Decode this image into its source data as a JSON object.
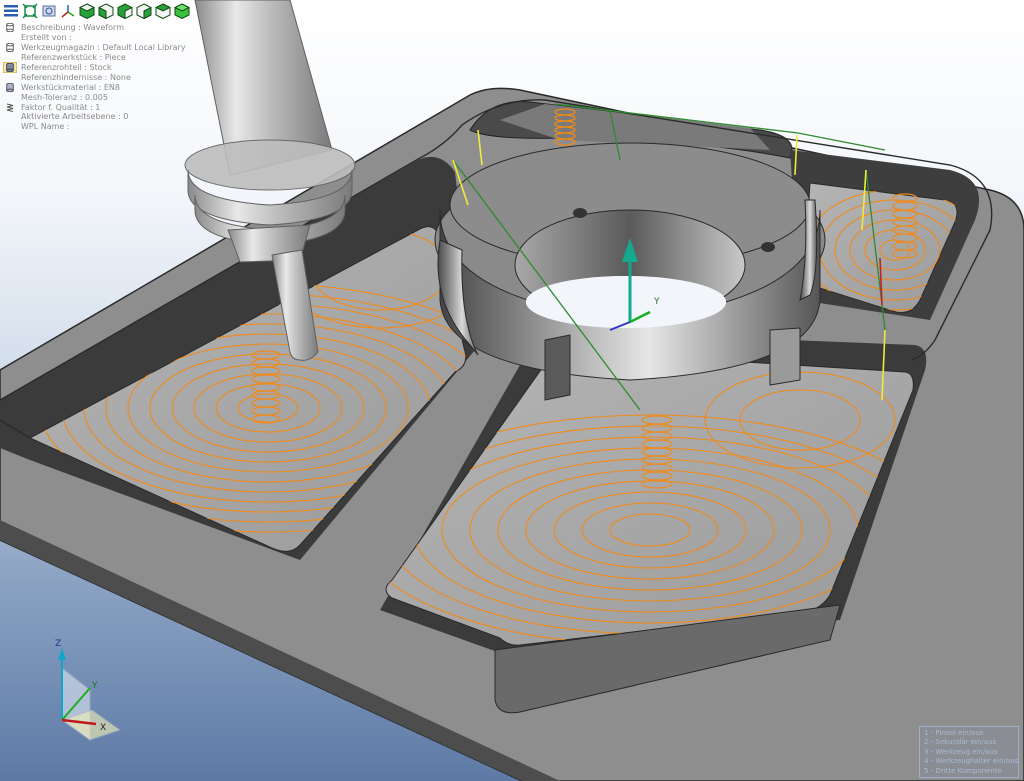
{
  "toolbar": {
    "buttons": [
      {
        "name": "menu-icon"
      },
      {
        "name": "fit-view-icon"
      },
      {
        "name": "zoom-icon"
      },
      {
        "name": "axis-view-icon"
      },
      {
        "name": "view-cube-iso-icon"
      },
      {
        "name": "view-cube-front-icon"
      },
      {
        "name": "view-cube-top-icon"
      },
      {
        "name": "view-cube-side-icon"
      },
      {
        "name": "view-cube-back-icon"
      },
      {
        "name": "view-cube-shaded-icon"
      }
    ]
  },
  "info_panel": {
    "lines": [
      {
        "text": "Beschreibung : Waveform",
        "icon": "cylinder-outline-icon"
      },
      {
        "text": "Erstellt von : ",
        "icon": ""
      },
      {
        "text": "Werkzeugmagazin : Default Local Library",
        "icon": "cylinder-outline-icon"
      },
      {
        "text": "Referenzwerkstück : Piece",
        "icon": ""
      },
      {
        "text": "Referenzrohteil : Stock",
        "icon": "cylinder-filled-icon"
      },
      {
        "text": "Referenzhindernisse : None",
        "icon": ""
      },
      {
        "text": "Werkstückmaterial : EN8",
        "icon": "cylinder-outline-icon"
      },
      {
        "text": "Mesh-Toleranz : 0.005",
        "icon": ""
      },
      {
        "text": "Faktor f. Qualität : 1",
        "icon": "spring-icon"
      },
      {
        "text": "Aktivierte Arbeitsebene : 0",
        "icon": ""
      },
      {
        "text": "WPL Name : ",
        "icon": ""
      }
    ]
  },
  "triad": {
    "x_label": "X",
    "y_label": "Y",
    "z_label": "Z"
  },
  "origin_triad": {
    "y_label": "Y"
  },
  "legend": {
    "items": [
      "1 - Pinsel ein/aus",
      "2 - Sekundär ein/aus",
      "3 - Werkzeug ein/aus",
      "4 - Werkzeughalter ein/aus",
      "5 - Dritte Komponente"
    ]
  },
  "colors": {
    "toolpath": "#f08a1a",
    "rapid_move": "#2f8a2f",
    "approach_move": "#f2ea3a",
    "part": "#8c8c8c",
    "part_dark": "#3d3d3d",
    "background_top": "#ffffff",
    "background_bottom": "#5d7aa6"
  }
}
